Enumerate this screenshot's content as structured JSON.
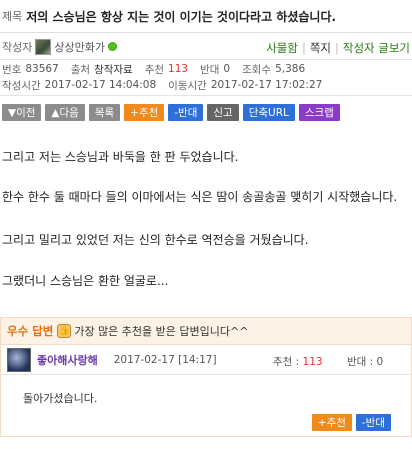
{
  "post": {
    "title_label": "제목",
    "title": "저의 스승님은 항상 지는 것이 이기는 것이다라고 하셨습니다.",
    "author_label": "작성자",
    "author_nick": "상상만화가",
    "author_links": [
      "사물함",
      "쪽지",
      "작성자 글보기"
    ],
    "meta1": [
      {
        "k": "번호",
        "v": "83567"
      },
      {
        "k": "출처",
        "v": "창작자료"
      },
      {
        "k": "추천",
        "v": "113"
      },
      {
        "k": "반대",
        "v": "0"
      },
      {
        "k": "조회수",
        "v": "5,386"
      }
    ],
    "meta2": [
      {
        "k": "작성시간",
        "v": "2017-02-17 14:04:08"
      },
      {
        "k": "이동시간",
        "v": "2017-02-17 17:02:27"
      }
    ]
  },
  "buttons": {
    "prev": "▼이전",
    "next": "▲다음",
    "list": "목록",
    "recommend": "+추천",
    "oppose": "-반대",
    "report": "신고",
    "short_url": "단축URL",
    "scrap": "스크랩"
  },
  "content": [
    "그리고 저는 스승님과 바둑을 한 판 두었습니다.",
    "한수 한수 둘 때마다 들의 이마에서는 식은 땀이 송골송골 맺히기 시작했습니다.",
    "그리고 밀리고 있었던 저는 신의 한수로 역전승을 거뒀습니다.",
    "그랬더니 스승님은 환한 얼굴로..."
  ],
  "best_reply": {
    "tag": "우수 답변",
    "thumb_glyph": "👍",
    "desc": "가장 많은 추천을 받은 답변입니다^^",
    "nick": "좋아해사랑해",
    "date": "2017-02-17 [14:17]",
    "vote_label": "추천 :",
    "vote_value": "113",
    "oppose_label": "반대 : 0",
    "body": "돌아가셨습니다.",
    "recommend_btn": "+추천",
    "oppose_btn": "-반대"
  },
  "colors": {
    "accent_orange": "#f08a1c",
    "accent_blue": "#2f6fd8",
    "link_green": "#2a7a15",
    "nick_purple": "#6a3aa8",
    "red": "#d33333"
  }
}
